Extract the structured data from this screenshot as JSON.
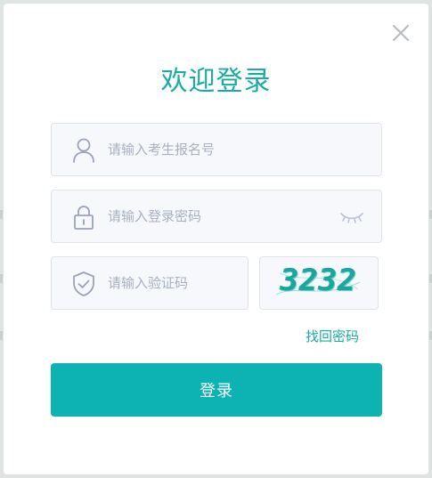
{
  "dialog": {
    "title": "欢迎登录",
    "close_icon": "close-icon"
  },
  "form": {
    "exam_id": {
      "placeholder": "请输入考生报名号",
      "value": "",
      "icon": "user-icon"
    },
    "password": {
      "placeholder": "请输入登录密码",
      "value": "",
      "icon": "lock-icon",
      "toggle_icon": "eye-closed-icon"
    },
    "captcha": {
      "placeholder": "请输入验证码",
      "value": "",
      "icon": "shield-check-icon",
      "image_text": "3232"
    },
    "forgot_password_label": "找回密码",
    "login_label": "登录"
  },
  "colors": {
    "accent": "#19aca4",
    "button": "#0db3b3",
    "field_bg": "#f6f8fc",
    "field_border": "#dfe3ec",
    "placeholder": "#a9b0bf",
    "icon_stroke": "#9aa3b8"
  }
}
